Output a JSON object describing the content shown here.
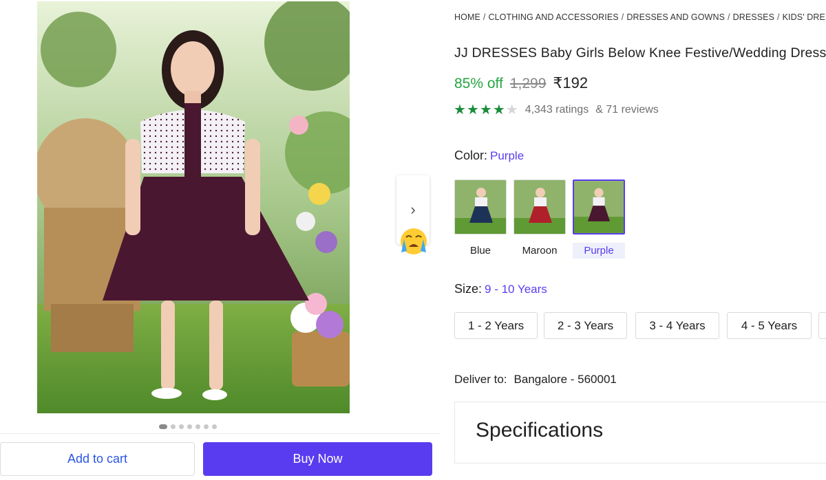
{
  "breadcrumb": [
    "HOME",
    "CLOTHING AND ACCESSORIES",
    "DRESSES AND GOWNS",
    "DRESSES",
    "KIDS' DRESSES"
  ],
  "product": {
    "title": "JJ DRESSES Baby Girls Below Knee Festive/Wedding Dress",
    "discount": "85% off",
    "mrp": "1,299",
    "price": "₹192",
    "rating_stars": 4,
    "ratings": "4,343 ratings",
    "reviews": "& 71 reviews"
  },
  "color": {
    "label": "Color:",
    "selected": "Purple",
    "options": [
      {
        "name": "Blue",
        "dress_color": "#1d3257"
      },
      {
        "name": "Maroon",
        "dress_color": "#b0202a"
      },
      {
        "name": "Purple",
        "dress_color": "#4a1730"
      }
    ]
  },
  "size": {
    "label": "Size:",
    "selected": "9 - 10 Years",
    "options": [
      "1 - 2 Years",
      "2 - 3 Years",
      "3 - 4 Years",
      "4 - 5 Years"
    ]
  },
  "delivery": {
    "label": "Deliver to:",
    "location": "Bangalore - 560001"
  },
  "specifications": {
    "title": "Specifications"
  },
  "actions": {
    "add_to_cart": "Add to cart",
    "buy_now": "Buy Now"
  },
  "carousel": {
    "total": 7,
    "active": 1
  },
  "icons": {
    "next": "chevron-right-icon",
    "emoji": "crying-face-icon"
  },
  "colors": {
    "accent": "#5a3cf0",
    "discount_green": "#26a541",
    "star_green": "#1a8c3b"
  }
}
